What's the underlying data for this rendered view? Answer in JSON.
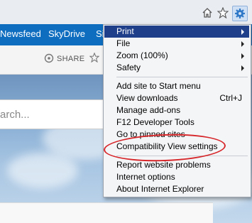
{
  "nav": {
    "links": [
      "Newsfeed",
      "SkyDrive",
      "Si"
    ]
  },
  "share": {
    "label": "SHARE"
  },
  "search": {
    "placeholder_text": "arch..."
  },
  "toolbar": {
    "icons": [
      "home-icon",
      "favorites-star-icon",
      "tools-gear-icon"
    ]
  },
  "tools_menu": {
    "items": [
      {
        "label": "Print",
        "submenu": true,
        "highlighted": true
      },
      {
        "label": "File",
        "submenu": true
      },
      {
        "label": "Zoom (100%)",
        "submenu": true
      },
      {
        "label": "Safety",
        "submenu": true
      },
      {
        "label": "Add site to Start menu"
      },
      {
        "label": "View downloads",
        "shortcut": "Ctrl+J"
      },
      {
        "label": "Manage add-ons"
      },
      {
        "label": "F12 Developer Tools"
      },
      {
        "label": "Go to pinned sites"
      },
      {
        "label": "Compatibility View settings",
        "circled": true
      },
      {
        "label": "Report website problems"
      },
      {
        "label": "Internet options"
      },
      {
        "label": "About Internet Explorer"
      }
    ]
  },
  "colors": {
    "highlight": "#1f3f8a",
    "annotation": "#d6262a",
    "navbar": "#0e6dbf"
  }
}
